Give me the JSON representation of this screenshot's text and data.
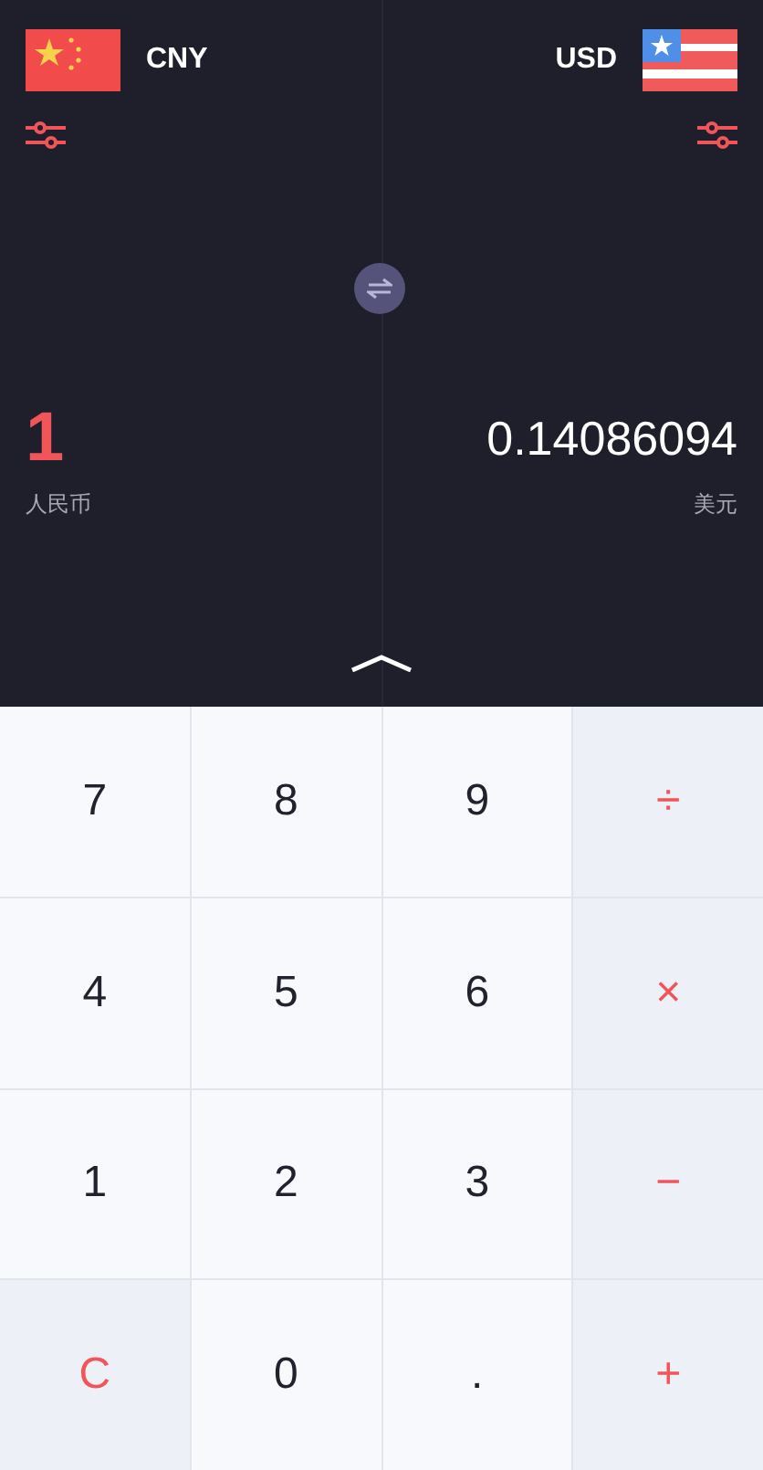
{
  "from": {
    "code": "CNY",
    "amount": "1",
    "name": "人民币"
  },
  "to": {
    "code": "USD",
    "amount": "0.14086094",
    "name": "美元"
  },
  "keys": [
    {
      "label": "7",
      "kind": "digit"
    },
    {
      "label": "8",
      "kind": "digit"
    },
    {
      "label": "9",
      "kind": "digit"
    },
    {
      "label": "÷",
      "kind": "action"
    },
    {
      "label": "4",
      "kind": "digit"
    },
    {
      "label": "5",
      "kind": "digit"
    },
    {
      "label": "6",
      "kind": "digit"
    },
    {
      "label": "×",
      "kind": "action"
    },
    {
      "label": "1",
      "kind": "digit"
    },
    {
      "label": "2",
      "kind": "digit"
    },
    {
      "label": "3",
      "kind": "digit"
    },
    {
      "label": "−",
      "kind": "action"
    },
    {
      "label": "C",
      "kind": "action"
    },
    {
      "label": "0",
      "kind": "digit"
    },
    {
      "label": ".",
      "kind": "digit"
    },
    {
      "label": "+",
      "kind": "action"
    }
  ]
}
